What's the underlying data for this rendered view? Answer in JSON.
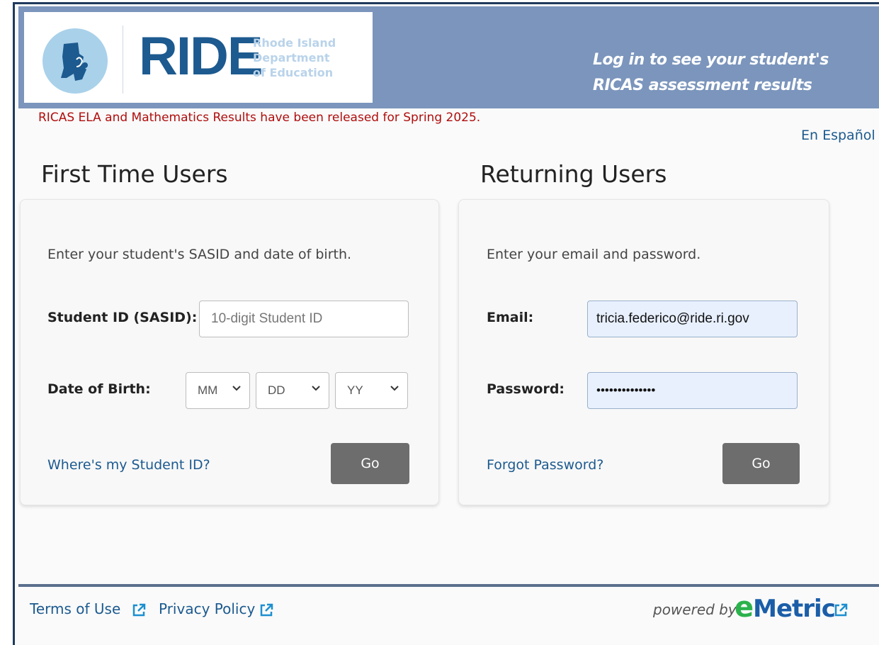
{
  "header": {
    "logo_text": "RIDE",
    "logo_sub": [
      "Rhode Island",
      "Department",
      "of Education"
    ],
    "tagline": [
      "Log in to see your student's",
      "RICAS assessment results"
    ]
  },
  "notice": "RICAS ELA and Mathematics Results have been released for Spring 2025.",
  "language_link": "En Español",
  "first_time": {
    "title": "First Time Users",
    "instruction": "Enter your student's SASID and date of birth.",
    "student_id_label": "Student ID (SASID):",
    "student_id_placeholder": "10-digit Student ID",
    "dob_label": "Date of Birth:",
    "dob_month": "MM",
    "dob_day": "DD",
    "dob_year": "YY",
    "help_link": "Where's my Student ID?",
    "go_label": "Go"
  },
  "returning": {
    "title": "Returning Users",
    "instruction": "Enter your email and password.",
    "email_label": "Email:",
    "email_value": "tricia.federico@ride.ri.gov",
    "password_label": "Password:",
    "password_value": "••••••••••••••",
    "forgot_link": "Forgot Password?",
    "go_label": "Go"
  },
  "footer": {
    "terms": "Terms of Use",
    "privacy": "Privacy Policy",
    "powered_by": "powered by",
    "brand_e": "e",
    "brand_rest": "Metric"
  },
  "colors": {
    "header": "#7b95bc",
    "brand": "#1c5a8f",
    "notice": "#b00d0d",
    "button": "#6d6d6d"
  },
  "icons": [
    "rhode-island-map-icon",
    "chevron-down-icon",
    "external-link-icon"
  ]
}
